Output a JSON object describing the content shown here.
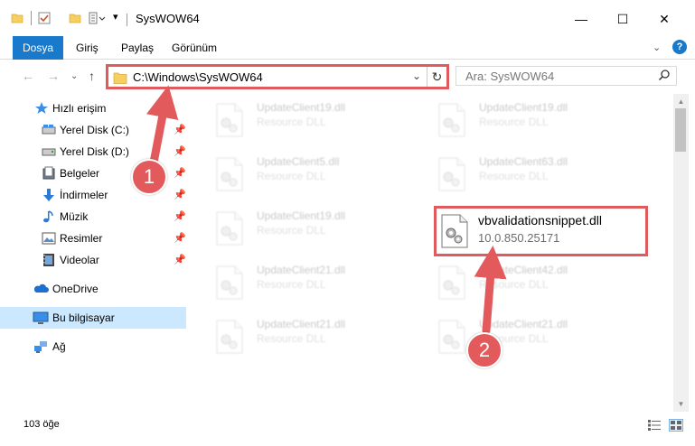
{
  "window": {
    "title": "SysWOW64",
    "minimize_glyph": "—",
    "maximize_glyph": "☐",
    "close_glyph": "✕"
  },
  "ribbon": {
    "tabs": [
      "Dosya",
      "Giriş",
      "Paylaş",
      "Görünüm"
    ],
    "expand_glyph": "⌄",
    "help_glyph": "?"
  },
  "address": {
    "path": "C:\\Windows\\SysWOW64",
    "search_placeholder": "Ara: SysWOW64"
  },
  "sidebar": {
    "quick_access": "Hızlı erişim",
    "items": [
      {
        "label": "Yerel Disk (C:)",
        "icon": "drive-icon"
      },
      {
        "label": "Yerel Disk (D:)",
        "icon": "drive-icon"
      },
      {
        "label": "Belgeler",
        "icon": "documents-icon"
      },
      {
        "label": "İndirmeler",
        "icon": "downloads-icon"
      },
      {
        "label": "Müzik",
        "icon": "music-icon"
      },
      {
        "label": "Resimler",
        "icon": "pictures-icon"
      },
      {
        "label": "Videolar",
        "icon": "videos-icon"
      }
    ],
    "onedrive": "OneDrive",
    "this_pc": "Bu bilgisayar",
    "network": "Ağ"
  },
  "files": [
    {
      "name": "UpdateClient19.dll",
      "desc": "Resource DLL"
    },
    {
      "name": "UpdateClient19.dll",
      "desc": "Resource DLL"
    },
    {
      "name": "UpdateClient5.dll",
      "desc": "Resource DLL"
    },
    {
      "name": "UpdateClient63.dll",
      "desc": "Resource DLL"
    },
    {
      "name": "UpdateClient19.dll",
      "desc": "Resource DLL"
    },
    {
      "name": "vbvalidationsnippet.dll",
      "desc": "10.0.850.25171"
    },
    {
      "name": "UpdateClient21.dll",
      "desc": "Resource DLL"
    },
    {
      "name": "UpdateClient42.dll",
      "desc": "Resource DLL"
    },
    {
      "name": "UpdateClient21.dll",
      "desc": "Resource DLL"
    },
    {
      "name": "UpdateClient21.dll",
      "desc": "Resource DLL"
    }
  ],
  "status": {
    "item_count": "103 öğe"
  },
  "callouts": {
    "one": "1",
    "two": "2"
  },
  "colors": {
    "accent": "#1979ca",
    "callout": "#e35a5c",
    "selection": "#cce8ff"
  }
}
